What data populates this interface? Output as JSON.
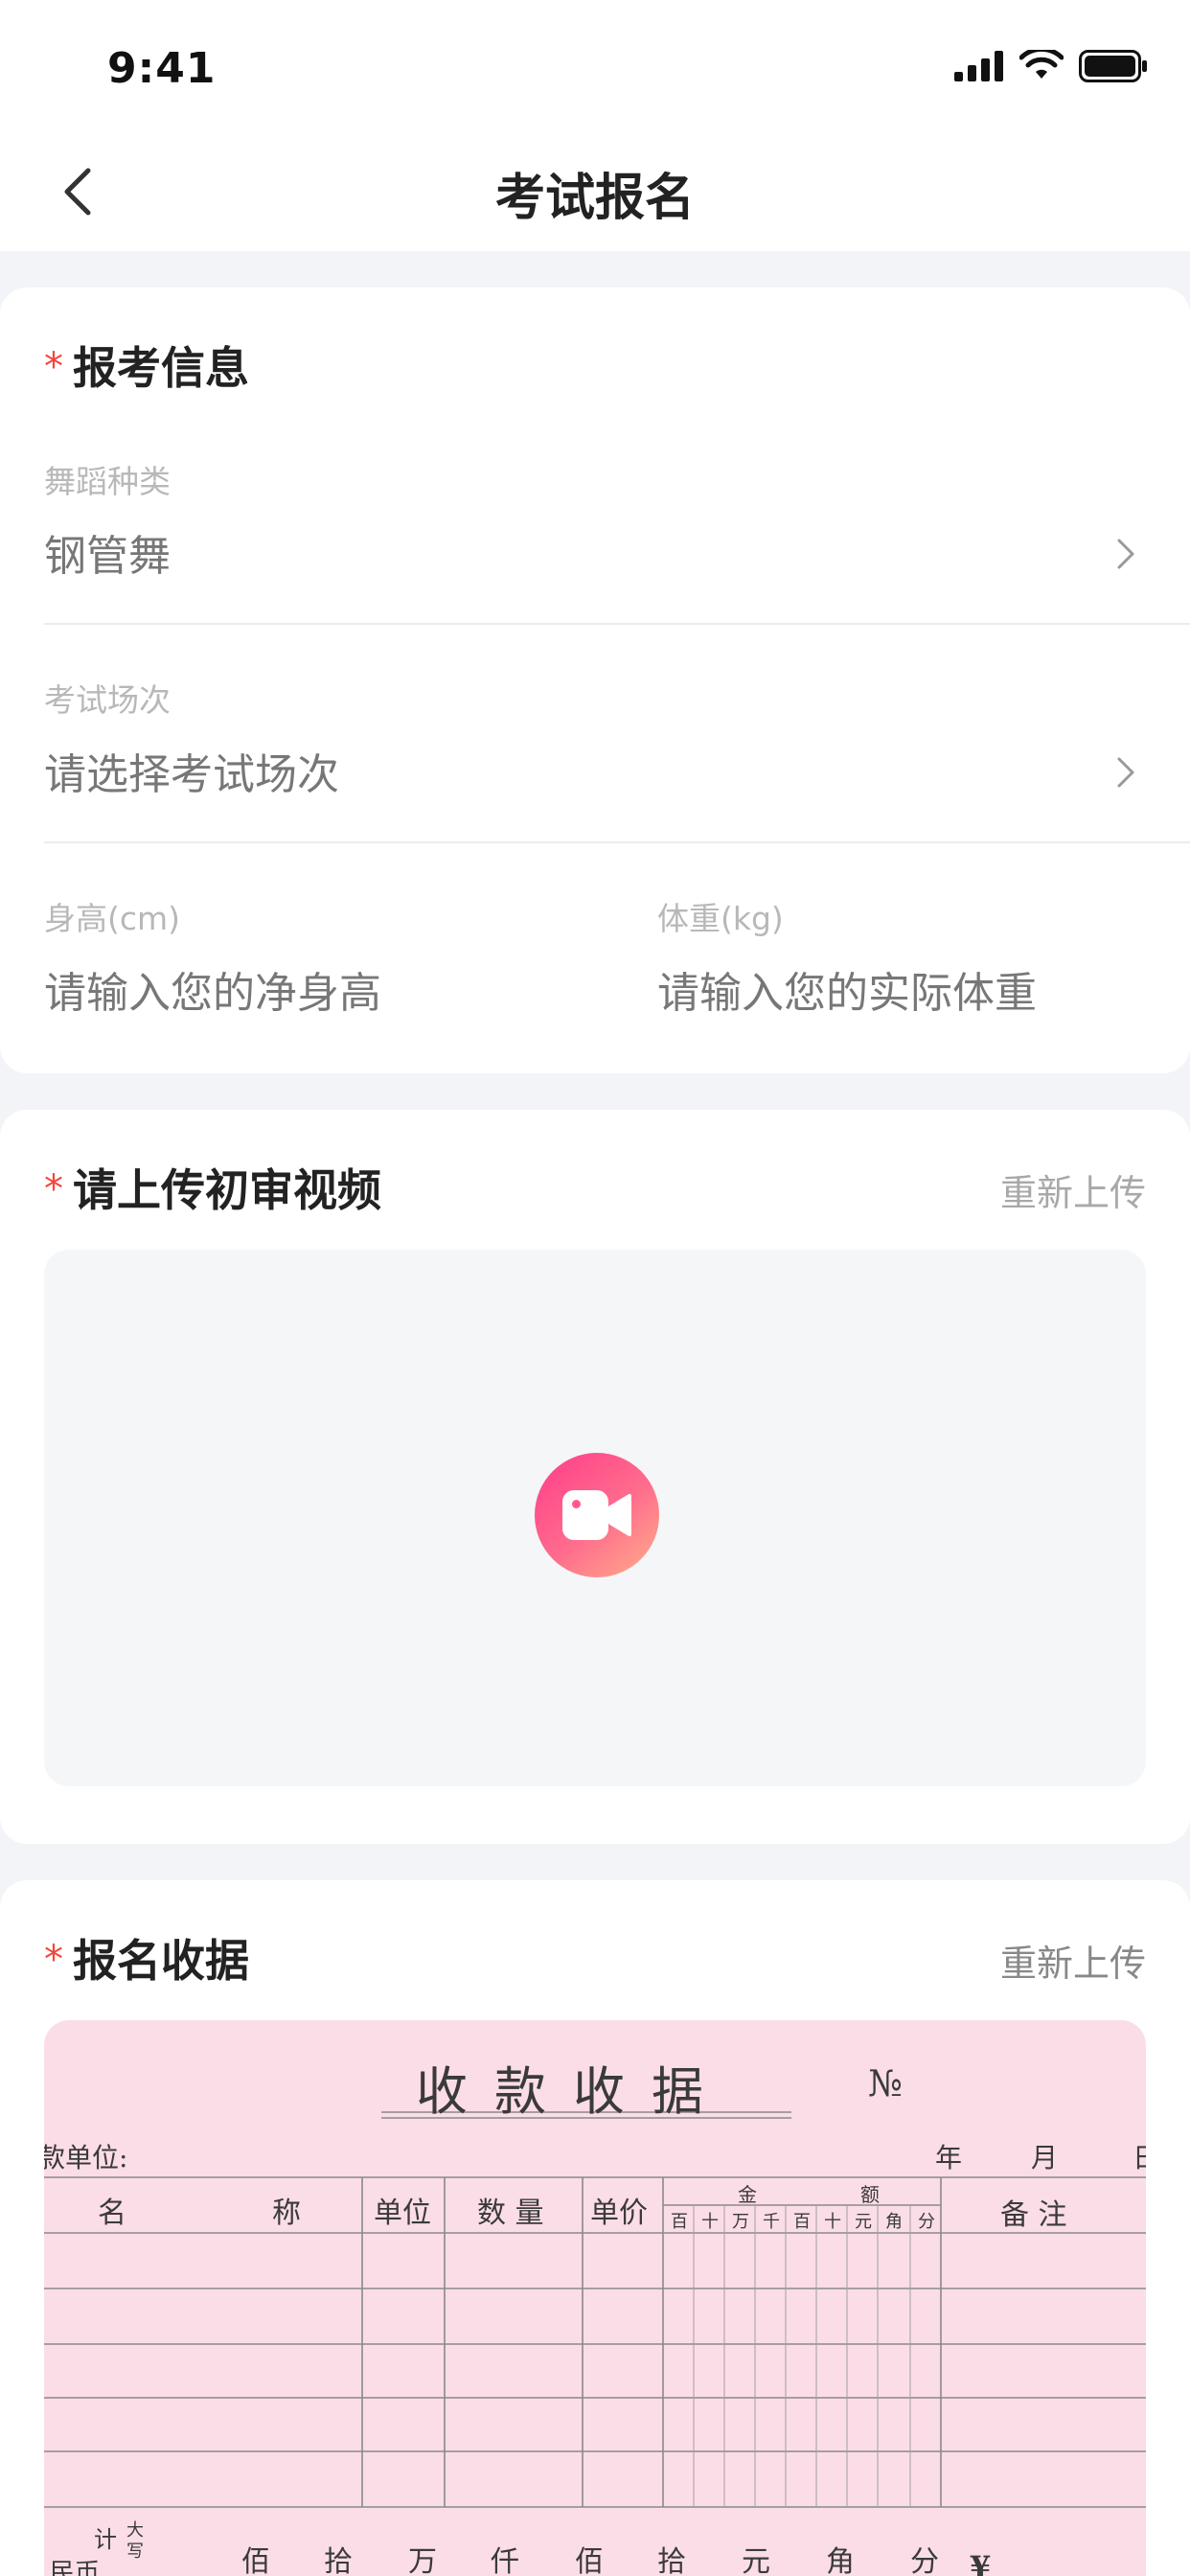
{
  "status_bar": {
    "time": "9:41"
  },
  "nav": {
    "title": "考试报名"
  },
  "exam_info": {
    "title": "报考信息",
    "dance_type": {
      "label": "舞蹈种类",
      "value": "钢管舞"
    },
    "session": {
      "label": "考试场次",
      "placeholder": "请选择考试场次"
    },
    "height": {
      "label": "身高(cm)",
      "placeholder": "请输入您的净身高"
    },
    "weight": {
      "label": "体重(kg)",
      "placeholder": "请输入您的实际体重"
    }
  },
  "video": {
    "title": "请上传初审视频",
    "reupload": "重新上传",
    "icon": "video-camera-icon"
  },
  "receipt": {
    "title": "报名收据",
    "reupload": "重新上传",
    "doc_title": "收款收据",
    "doc_no": "№",
    "payer": "款单位:",
    "year": "年",
    "month": "月",
    "day": "日",
    "col_name": "名",
    "col_name2": "称",
    "col_unit": "单位",
    "col_qty": "数 量",
    "col_price": "单价",
    "col_amount_a": "金",
    "col_amount_b": "额",
    "col_note": "备  注",
    "digits": [
      "百",
      "十",
      "万",
      "千",
      "百",
      "十",
      "元",
      "角",
      "分"
    ],
    "total_ji": "计",
    "total_rmb": "民币",
    "total_big": "大写",
    "big_units": [
      "佰",
      "拾",
      "万",
      "仟",
      "佰",
      "拾",
      "元",
      "角",
      "分"
    ],
    "yen": "¥"
  },
  "colors": {
    "accent_red": "#f2473c",
    "receipt_bg": "#fbdde8",
    "video_gradient_start": "#ff3d8a",
    "video_gradient_end": "#ffb08a"
  }
}
